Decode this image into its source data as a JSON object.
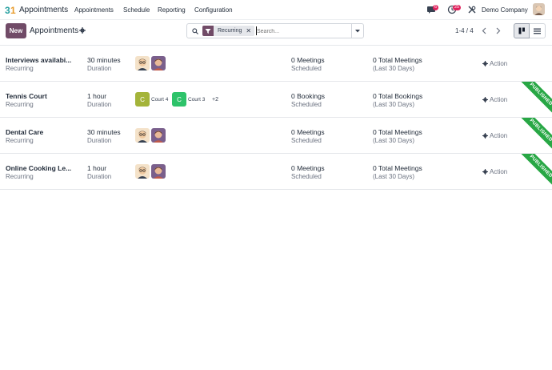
{
  "navbar": {
    "app_name": "Appointments",
    "menu": [
      "Appointments",
      "Schedule",
      "Reporting",
      "Configuration"
    ],
    "chat_badge": "6",
    "activity_badge": "25",
    "company": "Demo Company"
  },
  "control_panel": {
    "new_label": "New",
    "title": "Appointments",
    "search": {
      "facet": "Recurring",
      "placeholder": "Search..."
    },
    "pager": "1-4 / 4"
  },
  "rows": [
    {
      "name": "Interviews availabi...",
      "type": "Recurring",
      "duration": "30 minutes",
      "duration_label": "Duration",
      "resources": [],
      "count": "0 Meetings",
      "count_label": "Scheduled",
      "total": "0 Total Meetings",
      "total_label": "(Last 30 Days)",
      "action": "Action",
      "published": false
    },
    {
      "name": "Tennis Court",
      "type": "Recurring",
      "duration": "1 hour",
      "duration_label": "Duration",
      "resources": [
        {
          "initial": "C",
          "label": "Court 4",
          "color": "#a4b43a"
        },
        {
          "initial": "C",
          "label": "Court 3",
          "color": "#2ec36a"
        }
      ],
      "more": "+2",
      "count": "0 Bookings",
      "count_label": "Scheduled",
      "total": "0 Total Bookings",
      "total_label": "(Last 30 Days)",
      "action": "Action",
      "published": true
    },
    {
      "name": "Dental Care",
      "type": "Recurring",
      "duration": "30 minutes",
      "duration_label": "Duration",
      "resources": [],
      "count": "0 Meetings",
      "count_label": "Scheduled",
      "total": "0 Total Meetings",
      "total_label": "(Last 30 Days)",
      "action": "Action",
      "published": true
    },
    {
      "name": "Online Cooking Le...",
      "type": "Recurring",
      "duration": "1 hour",
      "duration_label": "Duration",
      "resources": [],
      "count": "0 Meetings",
      "count_label": "Scheduled",
      "total": "0 Total Meetings",
      "total_label": "(Last 30 Days)",
      "action": "Action",
      "published": true
    }
  ],
  "ribbon_label": "PUBLISHED",
  "colors": {
    "brand": "#714b67",
    "ribbon": "#28a745",
    "badge": "#e0245e"
  }
}
